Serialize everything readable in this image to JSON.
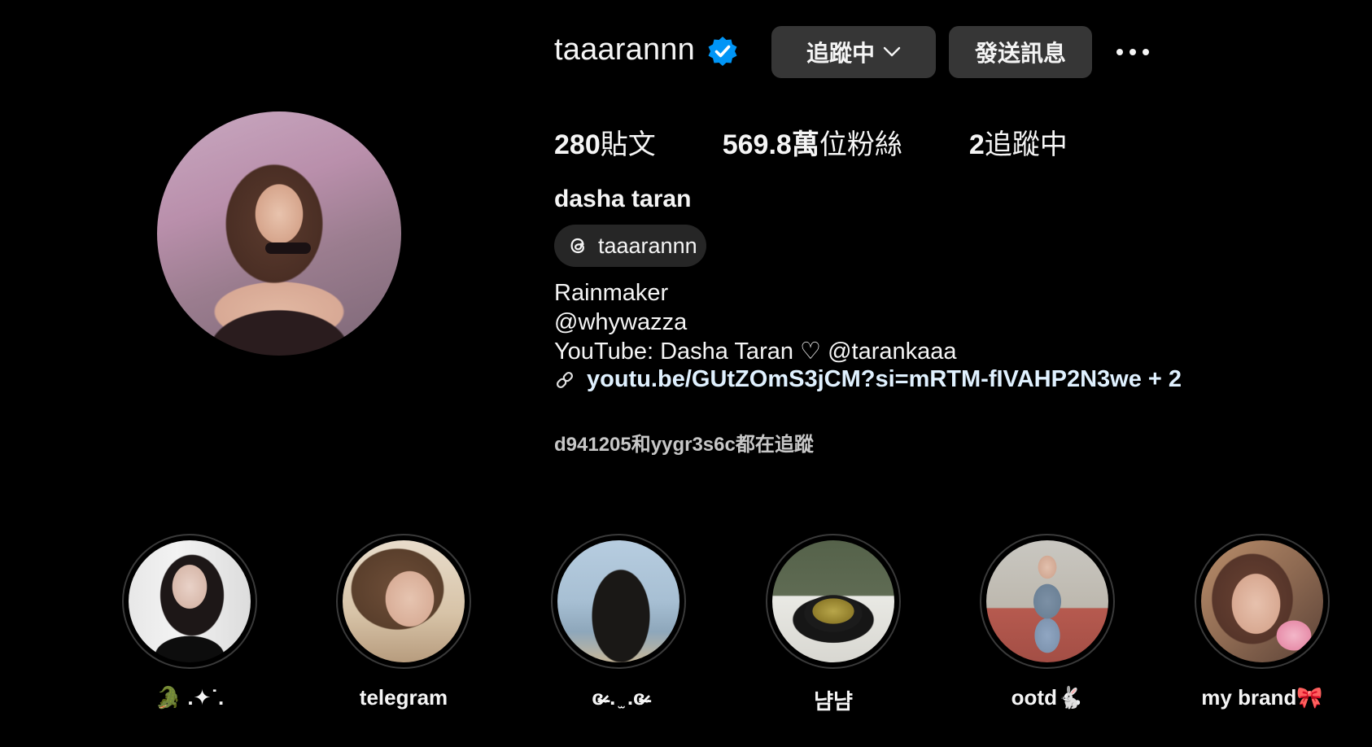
{
  "profile": {
    "username": "taaarannn",
    "verified": true,
    "following_button_label": "追蹤中",
    "message_button_label": "發送訊息",
    "posts_count": "280",
    "posts_label": "貼文",
    "followers_count": "569.8萬",
    "followers_label": "位粉絲",
    "following_count": "2",
    "following_label": "追蹤中",
    "full_name": "dasha taran",
    "threads_handle": "taaarannn",
    "bio_lines": [
      "Rainmaker",
      "@whywazza",
      "YouTube: Dasha Taran ♡ @tarankaaa"
    ],
    "link_text": "youtu.be/GUtZOmS3jCM?si=mRTM-fIVAHP2N3we + 2",
    "followed_by": "d941205和yygr3s6c都在追蹤"
  },
  "highlights": [
    {
      "label": "🐊 .✦˙."
    },
    {
      "label": "telegram"
    },
    {
      "label": "ɞ̴̶̷ . ̫ .ɞ̴̶̷"
    },
    {
      "label": "냠냠"
    },
    {
      "label": "ootd🐇"
    },
    {
      "label": "my brand🎀"
    }
  ],
  "colors": {
    "background": "#000000",
    "button_bg": "#363636",
    "verified_blue": "#0095f6",
    "link": "#e0f1ff"
  },
  "icons": [
    "verified-badge-icon",
    "chevron-down-icon",
    "more-options-icon",
    "threads-icon",
    "link-icon"
  ]
}
